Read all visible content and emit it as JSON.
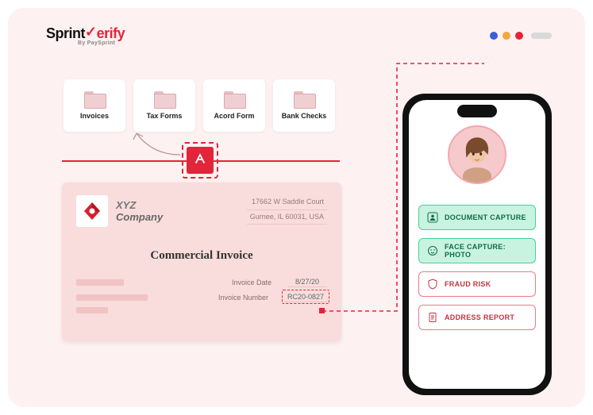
{
  "brand": {
    "part1": "Sprint",
    "part2": "erify",
    "sub": "By PaySprint"
  },
  "folders": [
    {
      "label": "Invoices"
    },
    {
      "label": "Tax Forms"
    },
    {
      "label": "Acord Form"
    },
    {
      "label": "Bank Checks"
    }
  ],
  "invoice": {
    "company_prefix": "XYZ",
    "company_word": "Company",
    "addr1": "17662 W Saddle Court",
    "addr2": "Gurnee, IL 60031, USA",
    "title": "Commercial Invoice",
    "date_label": "Invoice Date",
    "date_value": "8/27/20",
    "num_label": "Invoice Number",
    "num_value": "RC20-0827"
  },
  "phone": {
    "btn1": "DOCUMENT CAPTURE",
    "btn2": "FACE CAPTURE: PHOTO",
    "btn3": "FRAUD RISK",
    "btn4": "ADDRESS REPORT"
  }
}
